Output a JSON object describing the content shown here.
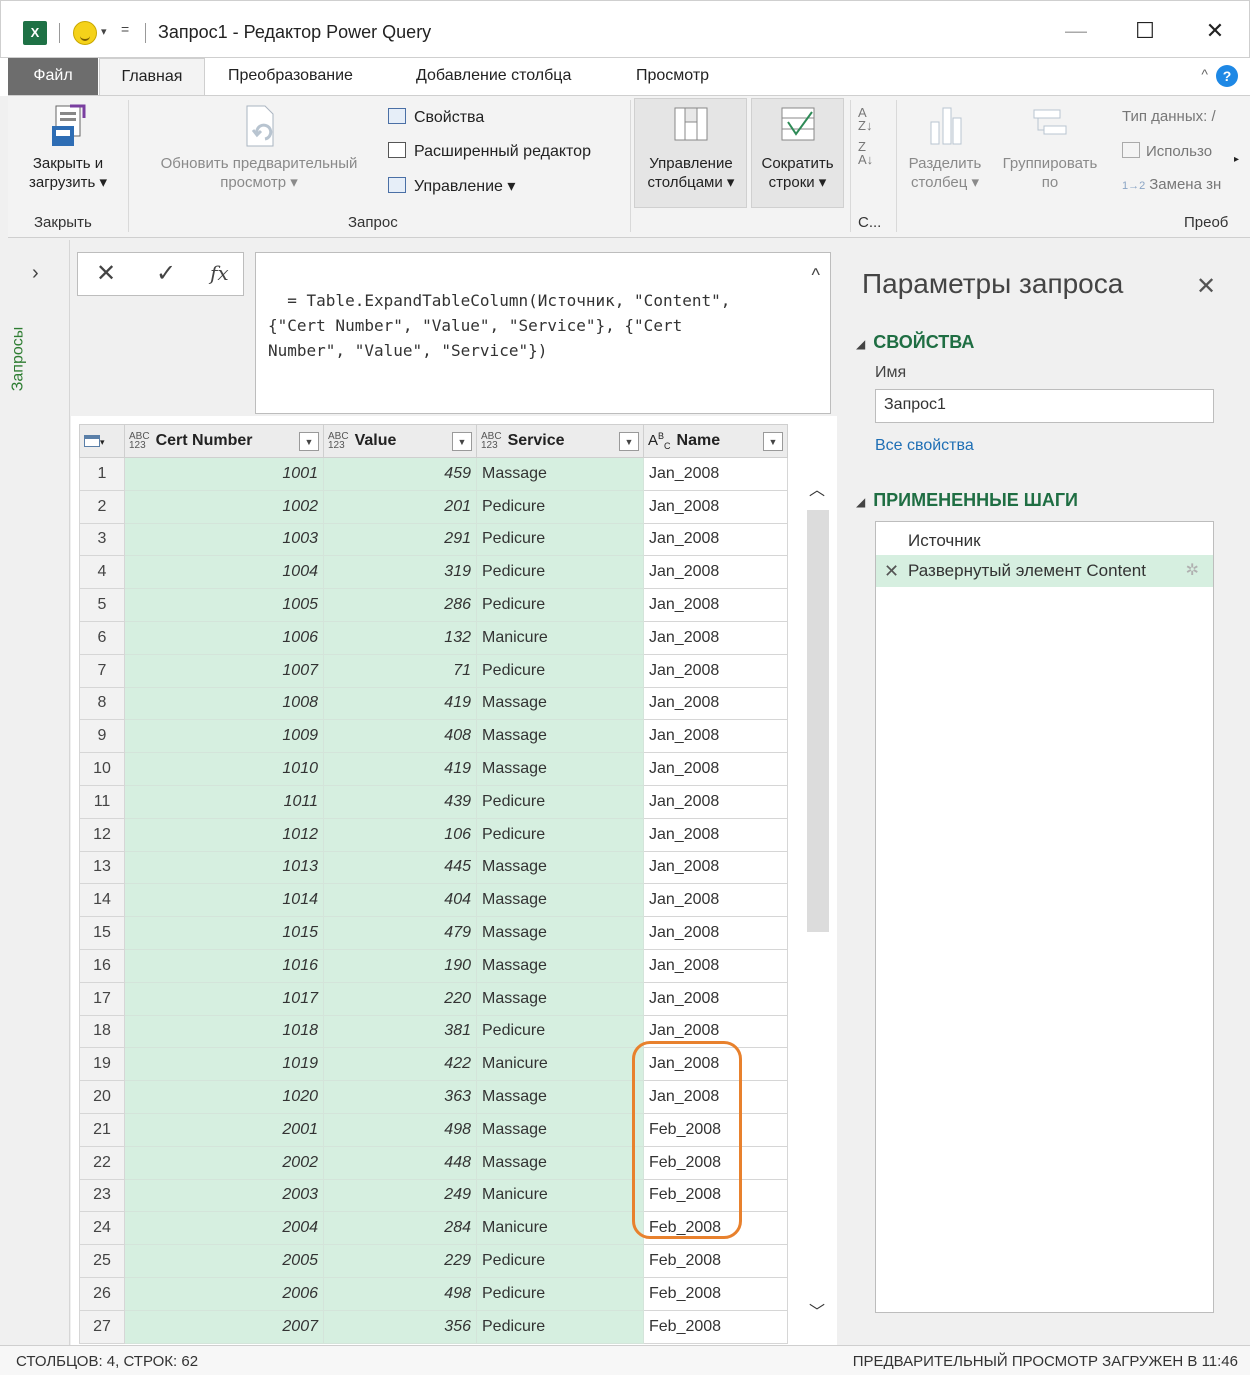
{
  "titlebar": {
    "app_icon": "excel-icon",
    "title": "Запрос1 - Редактор Power Query",
    "minimize": "—",
    "maximize": "☐",
    "close": "✕"
  },
  "tabs": {
    "file": "Файл",
    "items": [
      "Главная",
      "Преобразование",
      "Добавление столбца",
      "Просмотр"
    ],
    "active": "Главная"
  },
  "ribbon": {
    "close_load": [
      "Закрыть и",
      "загрузить ▾"
    ],
    "refresh": [
      "Обновить предварительный",
      "просмотр ▾"
    ],
    "properties": "Свойства",
    "advanced_editor": "Расширенный редактор",
    "manage": "Управление ▾",
    "manage_columns": [
      "Управление",
      "столбцами ▾"
    ],
    "reduce_rows": [
      "Сократить",
      "строки ▾"
    ],
    "split_column": [
      "Разделить",
      "столбец ▾"
    ],
    "group_by": [
      "Группировать",
      "по"
    ],
    "data_type": "Тип данных: /",
    "use_first_row": "Использо",
    "replace_values": "Замена зн",
    "groups": {
      "close": "Закрыть",
      "query": "Запрос",
      "sort": "С...",
      "transform": "Преоб"
    }
  },
  "left_pane": {
    "expand": "›",
    "label": "Запросы"
  },
  "formula": {
    "cancel": "✕",
    "confirm": "✓",
    "fx": "fx",
    "text": "= Table.ExpandTableColumn(Источник, \"Content\",\n{\"Cert Number\", \"Value\", \"Service\"}, {\"Cert\nNumber\", \"Value\", \"Service\"})",
    "collapse": "^"
  },
  "grid": {
    "columns": [
      {
        "type": "ABC/123",
        "name": "Cert Number"
      },
      {
        "type": "ABC/123",
        "name": "Value"
      },
      {
        "type": "ABC/123",
        "name": "Service"
      },
      {
        "type": "ABC",
        "name": "Name"
      }
    ],
    "rows": [
      [
        "1",
        "1001",
        "459",
        "Massage",
        "Jan_2008"
      ],
      [
        "2",
        "1002",
        "201",
        "Pedicure",
        "Jan_2008"
      ],
      [
        "3",
        "1003",
        "291",
        "Pedicure",
        "Jan_2008"
      ],
      [
        "4",
        "1004",
        "319",
        "Pedicure",
        "Jan_2008"
      ],
      [
        "5",
        "1005",
        "286",
        "Pedicure",
        "Jan_2008"
      ],
      [
        "6",
        "1006",
        "132",
        "Manicure",
        "Jan_2008"
      ],
      [
        "7",
        "1007",
        "71",
        "Pedicure",
        "Jan_2008"
      ],
      [
        "8",
        "1008",
        "419",
        "Massage",
        "Jan_2008"
      ],
      [
        "9",
        "1009",
        "408",
        "Massage",
        "Jan_2008"
      ],
      [
        "10",
        "1010",
        "419",
        "Massage",
        "Jan_2008"
      ],
      [
        "11",
        "1011",
        "439",
        "Pedicure",
        "Jan_2008"
      ],
      [
        "12",
        "1012",
        "106",
        "Pedicure",
        "Jan_2008"
      ],
      [
        "13",
        "1013",
        "445",
        "Massage",
        "Jan_2008"
      ],
      [
        "14",
        "1014",
        "404",
        "Massage",
        "Jan_2008"
      ],
      [
        "15",
        "1015",
        "479",
        "Massage",
        "Jan_2008"
      ],
      [
        "16",
        "1016",
        "190",
        "Massage",
        "Jan_2008"
      ],
      [
        "17",
        "1017",
        "220",
        "Massage",
        "Jan_2008"
      ],
      [
        "18",
        "1018",
        "381",
        "Pedicure",
        "Jan_2008"
      ],
      [
        "19",
        "1019",
        "422",
        "Manicure",
        "Jan_2008"
      ],
      [
        "20",
        "1020",
        "363",
        "Massage",
        "Jan_2008"
      ],
      [
        "21",
        "2001",
        "498",
        "Massage",
        "Feb_2008"
      ],
      [
        "22",
        "2002",
        "448",
        "Massage",
        "Feb_2008"
      ],
      [
        "23",
        "2003",
        "249",
        "Manicure",
        "Feb_2008"
      ],
      [
        "24",
        "2004",
        "284",
        "Manicure",
        "Feb_2008"
      ],
      [
        "25",
        "2005",
        "229",
        "Pedicure",
        "Feb_2008"
      ],
      [
        "26",
        "2006",
        "498",
        "Pedicure",
        "Feb_2008"
      ],
      [
        "27",
        "2007",
        "356",
        "Pedicure",
        "Feb_2008"
      ]
    ]
  },
  "right_pane": {
    "title": "Параметры запроса",
    "close": "✕",
    "properties_header": "СВОЙСТВА",
    "name_label": "Имя",
    "name_value": "Запрос1",
    "all_properties": "Все свойства",
    "steps_header": "ПРИМЕНЕННЫЕ ШАГИ",
    "steps": [
      "Источник",
      "Развернутый элемент Content"
    ],
    "selected_step": 1
  },
  "status": {
    "left": "СТОЛБЦОВ: 4, СТРОК: 62",
    "right": "ПРЕДВАРИТЕЛЬНЫЙ ПРОСМОТР ЗАГРУЖЕН В 11:46"
  },
  "colors": {
    "accent_green": "#1f6e43",
    "cell_green": "#d6efe0",
    "highlight_orange": "#e8812d"
  }
}
